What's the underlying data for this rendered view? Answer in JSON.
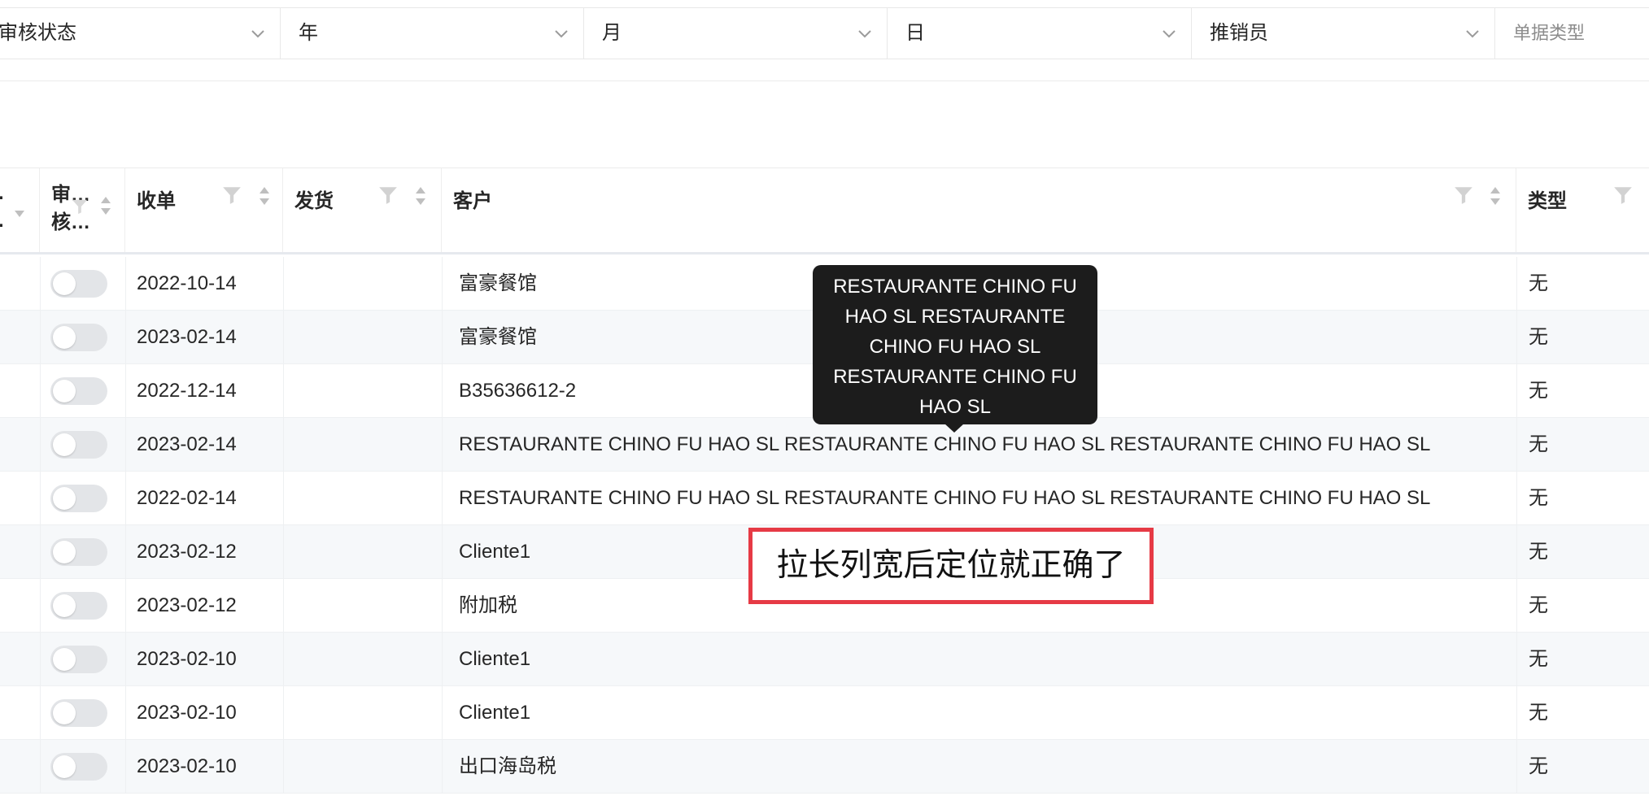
{
  "filters": [
    {
      "label": "审核状态",
      "icon": "chevron-down-icon"
    },
    {
      "label": "年",
      "icon": "chevron-down-icon"
    },
    {
      "label": "月",
      "icon": "chevron-down-icon"
    },
    {
      "label": "日",
      "icon": "chevron-down-icon"
    },
    {
      "label": "推销员",
      "icon": "chevron-down-icon"
    },
    {
      "placeholder": "单据类型"
    }
  ],
  "columns": {
    "audit": "审…\n核…",
    "received": "收单",
    "shipped": "发货",
    "customer": "客户",
    "type": "类型"
  },
  "rows": [
    {
      "date": "2022-10-14",
      "customer": "富豪餐馆",
      "type": "无"
    },
    {
      "date": "2023-02-14",
      "customer": "富豪餐馆",
      "type": "无"
    },
    {
      "date": "2022-12-14",
      "customer": "B35636612-2",
      "type": "无"
    },
    {
      "date": "2023-02-14",
      "customer": "RESTAURANTE CHINO FU HAO SL RESTAURANTE CHINO FU HAO SL RESTAURANTE CHINO FU HAO SL",
      "type": "无"
    },
    {
      "date": "2022-02-14",
      "customer": "RESTAURANTE CHINO FU HAO SL RESTAURANTE CHINO FU HAO SL RESTAURANTE CHINO FU HAO SL",
      "type": "无"
    },
    {
      "date": "2023-02-12",
      "customer": "Cliente1",
      "type": "无"
    },
    {
      "date": "2023-02-12",
      "customer": "附加税",
      "type": "无"
    },
    {
      "date": "2023-02-10",
      "customer": "Cliente1",
      "type": "无"
    },
    {
      "date": "2023-02-10",
      "customer": "Cliente1",
      "type": "无"
    },
    {
      "date": "2023-02-10",
      "customer": "出口海岛税",
      "type": "无"
    }
  ],
  "tooltip": {
    "lines": [
      "RESTAURANTE CHINO FU",
      "HAO SL RESTAURANTE",
      "CHINO FU HAO SL",
      "RESTAURANTE CHINO FU",
      "HAO SL"
    ]
  },
  "annotation": {
    "text": "拉长列宽后定位就正确了"
  },
  "colors": {
    "annotation_border": "#e63a45",
    "tooltip_bg": "#1c1c1c",
    "row_alt": "#f6f8fa"
  }
}
